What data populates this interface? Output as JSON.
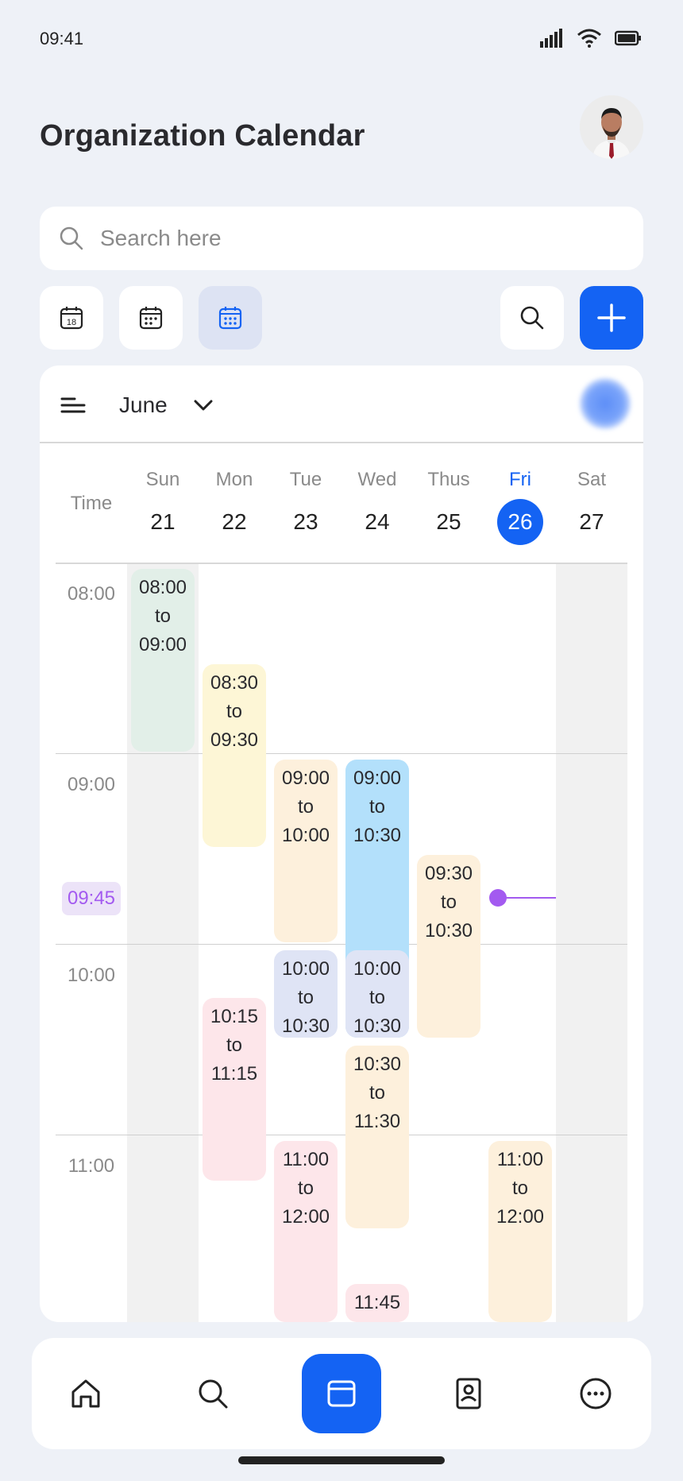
{
  "status_bar": {
    "time": "09:41"
  },
  "header": {
    "title": "Organization Calendar"
  },
  "search": {
    "placeholder": "Search here"
  },
  "calendar": {
    "month": "June",
    "time_header": "Time",
    "days": [
      {
        "name": "Sun",
        "num": "21"
      },
      {
        "name": "Mon",
        "num": "22"
      },
      {
        "name": "Tue",
        "num": "23"
      },
      {
        "name": "Wed",
        "num": "24"
      },
      {
        "name": "Thus",
        "num": "25"
      },
      {
        "name": "Fri",
        "num": "26",
        "today": true
      },
      {
        "name": "Sat",
        "num": "27"
      }
    ],
    "hours": [
      "08:00",
      "09:00",
      "10:00",
      "11:00"
    ],
    "now": "09:45",
    "events": [
      {
        "day": 0,
        "start": "08:00",
        "to": "to",
        "end": "09:00",
        "color": "#e2efe8"
      },
      {
        "day": 1,
        "start": "08:30",
        "to": "to",
        "end": "09:30",
        "color": "#fdf6d6"
      },
      {
        "day": 2,
        "start": "09:00",
        "to": "to",
        "end": "10:00",
        "color": "#fdf0dc"
      },
      {
        "day": 3,
        "start": "09:00",
        "to": "to",
        "end": "10:30",
        "color": "#b3e0fb"
      },
      {
        "day": 4,
        "start": "09:30",
        "to": "to",
        "end": "10:30",
        "color": "#fdf0dc"
      },
      {
        "day": 2,
        "start": "10:00",
        "to": "to",
        "end": "10:30",
        "color": "#dfe4f5"
      },
      {
        "day": 3,
        "start": "10:00",
        "to": "to",
        "end": "10:30",
        "color": "#dfe4f5"
      },
      {
        "day": 1,
        "start": "10:15",
        "to": "to",
        "end": "11:15",
        "color": "#fde6ea"
      },
      {
        "day": 3,
        "start": "10:30",
        "to": "to",
        "end": "11:30",
        "color": "#fdf0dc"
      },
      {
        "day": 2,
        "start": "11:00",
        "to": "to",
        "end": "12:00",
        "color": "#fde6ea"
      },
      {
        "day": 5,
        "start": "11:00",
        "to": "to",
        "end": "12:00",
        "color": "#fdf0dc"
      },
      {
        "day": 3,
        "start": "11:45",
        "to": "",
        "end": "",
        "color": "#fde6ea"
      }
    ]
  },
  "toolbar": {
    "day_view_icon_text": "18"
  },
  "colors": {
    "accent": "#1463f3",
    "now": "#a35af0"
  }
}
